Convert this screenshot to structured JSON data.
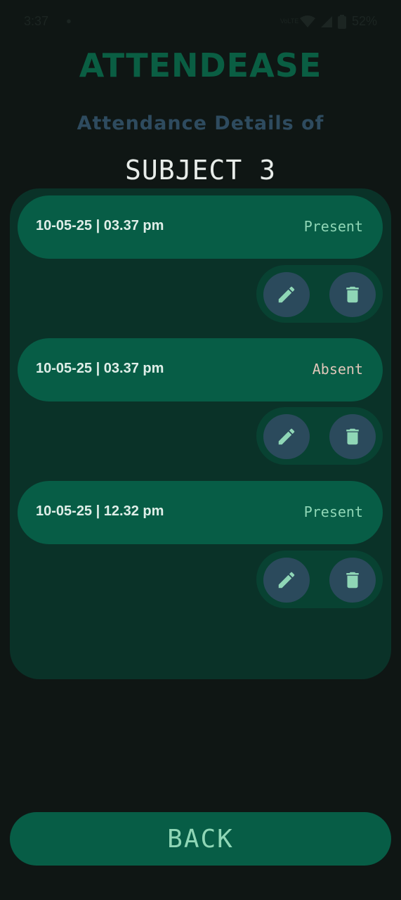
{
  "status_bar": {
    "time": "3:37",
    "network_label": "VoLTE",
    "battery": "52%"
  },
  "header": {
    "app_title": "ATTENDEASE",
    "subtitle": "Attendance Details of",
    "subject": "SUBJECT 3"
  },
  "records": [
    {
      "datetime": "10-05-25 | 03.37 pm",
      "status": "Present"
    },
    {
      "datetime": "10-05-25 | 03.37 pm",
      "status": "Absent"
    },
    {
      "datetime": "10-05-25 | 12.32 pm",
      "status": "Present"
    }
  ],
  "icons": {
    "edit": "pencil-icon",
    "delete": "trash-icon"
  },
  "colors": {
    "background": "#0f1614",
    "panel": "#0a3228",
    "pill": "#075d46",
    "accent": "#8fd6b6",
    "action_button": "#2b4a5c"
  },
  "footer": {
    "back_label": "BACK"
  }
}
